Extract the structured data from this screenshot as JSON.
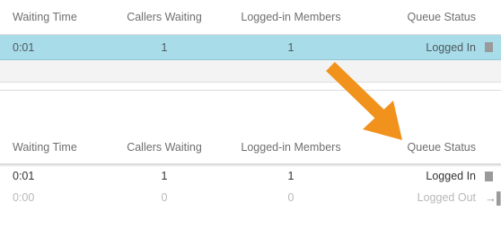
{
  "colors": {
    "selected_row": "#a8dce9",
    "arrow": "#f0921c"
  },
  "top_table": {
    "headers": {
      "waiting_time": "Waiting Time",
      "callers_waiting": "Callers Waiting",
      "logged_in_members": "Logged-in Members",
      "queue_status": "Queue Status"
    },
    "rows": [
      {
        "waiting_time": "0:01",
        "callers_waiting": "1",
        "logged_in_members": "1",
        "queue_status": "Logged In",
        "action_icon": "pause-icon"
      }
    ]
  },
  "bottom_table": {
    "headers": {
      "waiting_time": "Waiting Time",
      "callers_waiting": "Callers Waiting",
      "logged_in_members": "Logged-in Members",
      "queue_status": "Queue Status"
    },
    "rows": [
      {
        "waiting_time": "0:01",
        "callers_waiting": "1",
        "logged_in_members": "1",
        "queue_status": "Logged In",
        "action_icon": "pause-icon"
      },
      {
        "waiting_time": "0:00",
        "callers_waiting": "0",
        "logged_in_members": "0",
        "queue_status": "Logged Out",
        "action_icon": "login-icon"
      }
    ]
  },
  "annotation": {
    "icon": "arrow-icon",
    "direction": "down-right"
  }
}
